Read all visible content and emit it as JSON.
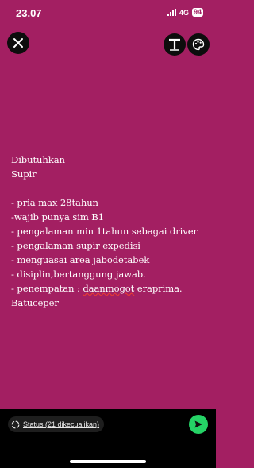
{
  "statusbar": {
    "time": "23.07",
    "network": "4G",
    "battery": "94"
  },
  "toolbar": {
    "close_icon": "close-icon",
    "text_icon": "text-tool-icon",
    "palette_icon": "palette-icon"
  },
  "post": {
    "lines_top": [
      "Dibutuhkan",
      "Supir"
    ],
    "lines_list": [
      "- pria max 28tahun",
      "-wajib punya sim B1",
      "- pengalaman min 1tahun sebagai driver",
      "- pengalaman supir expedisi",
      "- menguasai area jabodetabek",
      "- disiplin,bertanggung jawab."
    ],
    "placement_prefix": "- penempatan : ",
    "placement_underlined": "daanmogot",
    "placement_suffix": " eraprima.",
    "last_line": "Batuceper",
    "background_color": "#a31f62"
  },
  "footer": {
    "status_label": "Status (21 dikecualikan)",
    "send_color": "#25d366"
  }
}
